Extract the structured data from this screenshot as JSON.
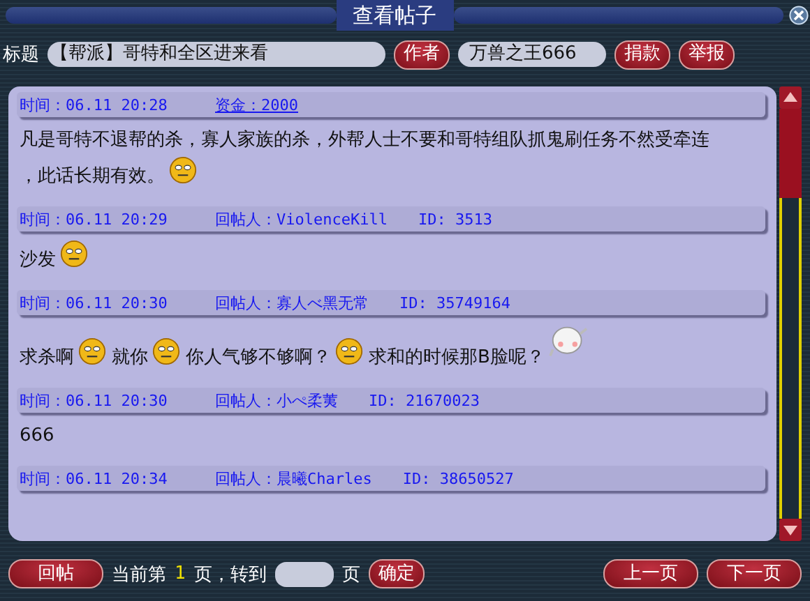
{
  "window": {
    "title": "查看帖子"
  },
  "topic": {
    "label": "标题",
    "value": "【帮派】哥特和全区进来看",
    "author_button": "作者",
    "author": "万兽之王666",
    "buttons": [
      "捐款",
      "举报"
    ]
  },
  "posts": [
    {
      "time": "时间：06.11 20:28",
      "fund_link": "资金：2000",
      "body": [
        {
          "kind": "text",
          "text": "凡是哥特不退帮的杀，寡人家族的杀，外帮人士不要和哥特组队抓鬼刷任务不然受牵连"
        },
        {
          "kind": "text",
          "text": "，此话长期有效。"
        },
        {
          "kind": "smiley"
        }
      ]
    },
    {
      "time": "时间：06.11 20:29",
      "poster": "回帖人：ViolenceKill",
      "id": "ID: 3513",
      "body": [
        {
          "kind": "text",
          "text": "沙发"
        },
        {
          "kind": "smiley"
        }
      ]
    },
    {
      "time": "时间：06.11 20:30",
      "poster": "回帖人：寡人べ黑无常",
      "id": "ID: 35749164",
      "body": [
        {
          "kind": "text",
          "text": "求杀啊"
        },
        {
          "kind": "smiley"
        },
        {
          "kind": "text",
          "text": "就你"
        },
        {
          "kind": "smiley"
        },
        {
          "kind": "text",
          "text": "你人气够不够啊？"
        },
        {
          "kind": "smiley"
        },
        {
          "kind": "text",
          "text": "求和的时候那B脸呢？"
        },
        {
          "kind": "bun"
        }
      ]
    },
    {
      "time": "时间：06.11 20:30",
      "poster": "回帖人：小ぺ柔荑",
      "id": "ID: 21670023",
      "body": [
        {
          "kind": "text",
          "text": "666"
        }
      ]
    },
    {
      "time": "时间：06.11 20:34",
      "poster": "回帖人：晨曦Charles",
      "id": "ID: 38650527"
    }
  ],
  "footer": {
    "reply_button": "回帖",
    "prefix": "当前第",
    "current": "1",
    "goto": "页，转到",
    "suffix": "页",
    "confirm_button": "确定",
    "prev_button": "上一页",
    "next_button": "下一页"
  }
}
